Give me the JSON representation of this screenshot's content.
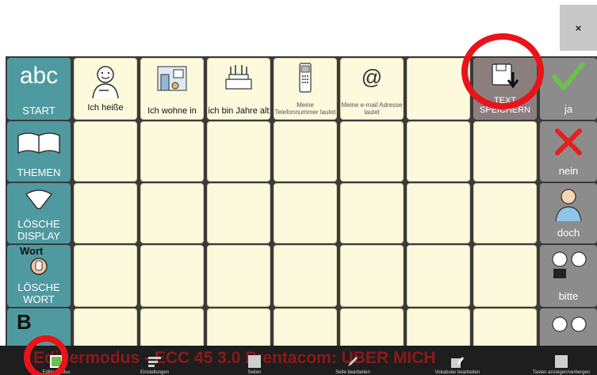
{
  "window": {
    "close_label": "×"
  },
  "nav": {
    "start": {
      "big": "abc",
      "label": "START"
    },
    "themen": {
      "label": "THEMEN"
    },
    "loesche_display": {
      "label": "LÖSCHE DISPLAY"
    },
    "loesche_wort": {
      "label": "LÖSCHE WORT",
      "top_text": "Wort"
    },
    "partial_letter": "B"
  },
  "phrases": [
    {
      "label": "Ich heiße",
      "style": "normal"
    },
    {
      "label": "Ich wohne in",
      "style": "normal"
    },
    {
      "label": "ich bin Jahre alt",
      "style": "normal"
    },
    {
      "label": "Meine Telefonnummer lautet",
      "style": "small"
    },
    {
      "label": "Meine e-mail Adresse lautet",
      "style": "small"
    },
    {
      "label": "",
      "style": "empty"
    }
  ],
  "save": {
    "label": "TEXT SPEICHERN"
  },
  "answers": {
    "ja": "ja",
    "nein": "nein",
    "doch": "doch",
    "bitte": "bitte"
  },
  "colors": {
    "teal": "#4f9aa0",
    "cream": "#fdf9dc",
    "gray": "#8c8c8c",
    "highlight_red": "#e8141a",
    "green_check": "#6dc04a"
  },
  "toolbar": {
    "mode_banner": "Editiermodus - ECC 45 3.0 Prentacom: ÜBER MICH",
    "items": [
      {
        "label": "Editiermodus",
        "icon": "checkbox-icon"
      },
      {
        "label": "Einstellungen",
        "icon": "settings-icon"
      },
      {
        "label": "Seiten",
        "icon": "pages-icon"
      },
      {
        "label": "Seite bearbeiten",
        "icon": "edit-page-icon"
      },
      {
        "label": "Vokabular bearbeiten",
        "icon": "edit-vocabulary-icon"
      },
      {
        "label": "Tasten anzeigen/verbergen",
        "icon": "toggle-keys-icon"
      }
    ]
  }
}
